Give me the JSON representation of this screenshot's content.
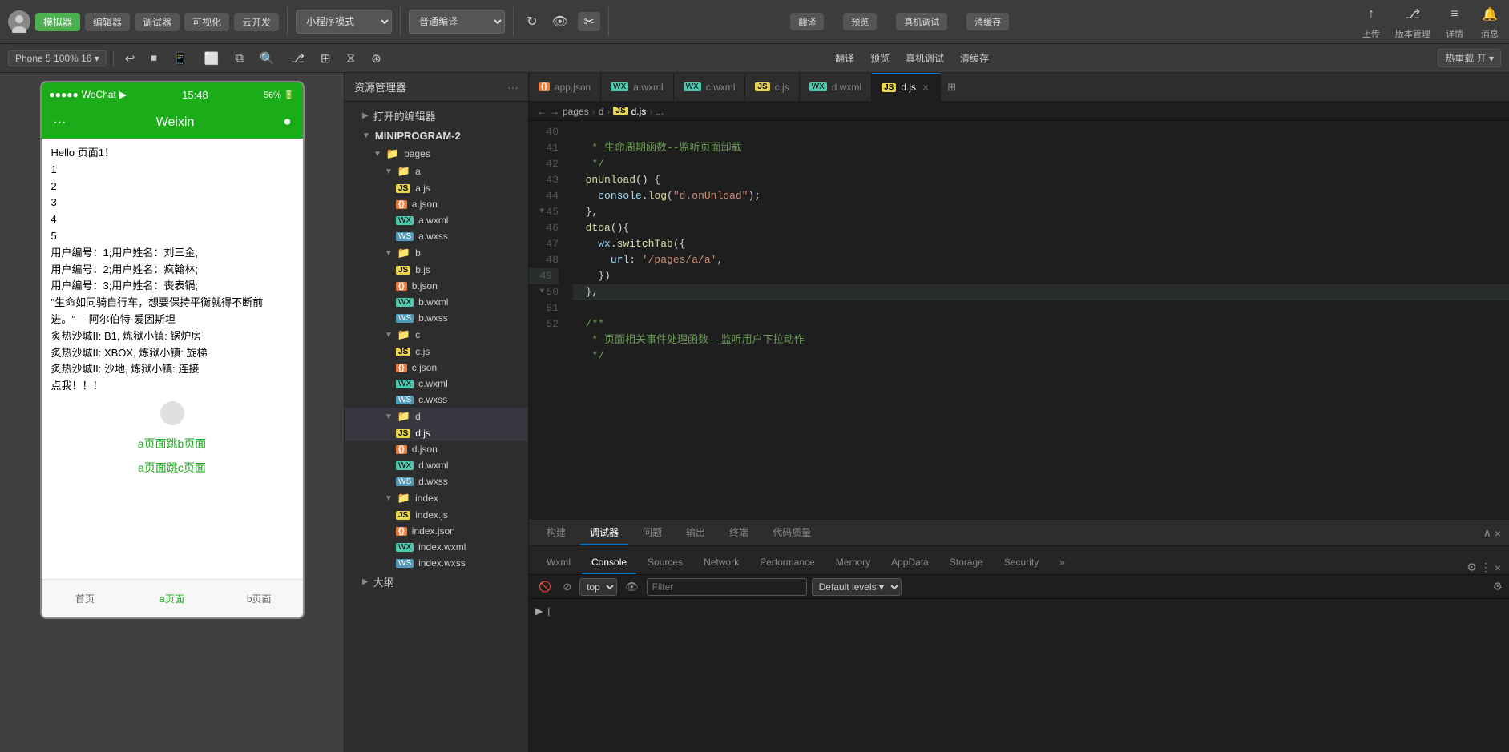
{
  "toolbar": {
    "avatar_label": "头",
    "btn_simulator": "模拟器",
    "btn_editor": "编辑器",
    "btn_debugger": "调试器",
    "btn_visual": "可视化",
    "btn_cloud": "云开发",
    "mode_label": "小程序模式",
    "compile_label": "普通编译",
    "btn_compile": "翻译",
    "btn_preview": "预览",
    "btn_real_debug": "真机调试",
    "btn_save": "清缓存",
    "btn_upload": "上传",
    "btn_version": "版本管理",
    "btn_details": "详情",
    "btn_messages": "消息"
  },
  "secondary": {
    "phone_info": "Phone 5 100% 16 ▾",
    "hotreload": "热重载 开 ▾"
  },
  "simulator": {
    "status_bar": {
      "left": "●●●●● WeChat ◀",
      "time": "15:48",
      "right": "56% 🔋"
    },
    "nav_title": "Weixin",
    "content": {
      "line1": "Hello 页面1！",
      "line2": "1",
      "line3": "2",
      "line4": "3",
      "line5": "4",
      "line6": "5",
      "user1": "用户编号：1;用户姓名：刘三金;",
      "user2": "用户编号：2;用户姓名：疯翰林;",
      "user3": "用户编号：3;用户姓名：丧表锅;",
      "quote": "\"生命如同骑自行车，想要保持平衡就得不断前进。\"— 阿尔伯特·爱因斯坦",
      "city1": "炙热沙城II: B1, 炼狱小镇: 锅炉房",
      "city2": "炙热沙城II: XBOX, 炼狱小镇: 旋梯",
      "city3": "炙热沙城II: 沙地, 炼狱小镇: 连接",
      "click": "点我！！！",
      "jump_b": "a页面跳b页面",
      "jump_c": "a页面跳c页面"
    },
    "tabs": {
      "home": "首页",
      "a_page": "a页面",
      "b_page": "b页面"
    }
  },
  "file_explorer": {
    "header": "资源管理器",
    "open_editor": "打开的编辑器",
    "project_name": "MINIPROGRAM-2",
    "pages_label": "pages",
    "folder_a": "a",
    "file_ajs": "a.js",
    "file_ajson": "a.json",
    "file_awxml": "a.wxml",
    "file_awxss": "a.wxss",
    "folder_b": "b",
    "file_bjs": "b.js",
    "file_bjson": "b.json",
    "file_bwxml": "b.wxml",
    "file_bwxss": "b.wxss",
    "folder_c": "c",
    "file_cjs": "c.js",
    "file_cjson": "c.json",
    "file_cwxml": "c.wxml",
    "file_cwxss": "c.wxss",
    "folder_d": "d",
    "file_djs": "d.js",
    "file_djson": "d.json",
    "file_dwxml": "d.wxml",
    "file_dwxss": "d.wxss",
    "folder_index": "index",
    "file_indexjs": "index.js",
    "file_indexjson": "index.json",
    "file_indexwxml": "index.wxml",
    "file_indexwxss": "index.wxss",
    "section_outline": "大纲"
  },
  "editor_tabs": [
    {
      "label": "app.json",
      "type": "json",
      "active": false
    },
    {
      "label": "a.wxml",
      "type": "wxml",
      "active": false
    },
    {
      "label": "c.wxml",
      "type": "wxml",
      "active": false
    },
    {
      "label": "c.js",
      "type": "js",
      "active": false
    },
    {
      "label": "d.wxml",
      "type": "wxml",
      "active": false
    },
    {
      "label": "d.js",
      "type": "js",
      "active": true,
      "closable": true
    }
  ],
  "breadcrumb": {
    "parts": [
      "pages",
      "d",
      "d.js",
      "..."
    ]
  },
  "code": {
    "lines": [
      {
        "num": 40,
        "text": "   * 生命周期函数--监听页面卸载",
        "class": "cmt"
      },
      {
        "num": 41,
        "text": "   */",
        "class": "cmt"
      },
      {
        "num": 42,
        "text": "  onUnload() {",
        "class": ""
      },
      {
        "num": 43,
        "text": "    console.log(\"d.onUnload\");",
        "class": ""
      },
      {
        "num": 44,
        "text": "  },",
        "class": ""
      },
      {
        "num": 45,
        "text": "  dtoa(){",
        "class": "",
        "arrow": true
      },
      {
        "num": 46,
        "text": "    wx.switchTab({",
        "class": ""
      },
      {
        "num": 47,
        "text": "      url: '/pages/a/a',",
        "class": ""
      },
      {
        "num": 48,
        "text": "    })",
        "class": ""
      },
      {
        "num": 49,
        "text": "  },",
        "class": "",
        "active": true
      },
      {
        "num": 50,
        "text": "  /**",
        "class": "cmt",
        "arrow": true
      },
      {
        "num": 51,
        "text": "   * 页面相关事件处理函数--监听用户下拉动作",
        "class": "cmt"
      },
      {
        "num": 52,
        "text": "   */",
        "class": "cmt"
      }
    ]
  },
  "devtools": {
    "header_tabs_build": "构建",
    "header_tabs_debugger": "调试器",
    "header_tabs_issues": "问题",
    "header_tabs_output": "输出",
    "header_tabs_terminal": "终端",
    "header_tabs_quality": "代码质量",
    "tabs": [
      "Wxml",
      "Console",
      "Sources",
      "Network",
      "Performance",
      "Memory",
      "AppData",
      "Storage",
      "Security",
      "»"
    ],
    "active_tab": "Console",
    "toolbar": {
      "select_context": "top",
      "filter_placeholder": "Filter",
      "levels_label": "Default levels ▾"
    },
    "prompt": ">"
  }
}
